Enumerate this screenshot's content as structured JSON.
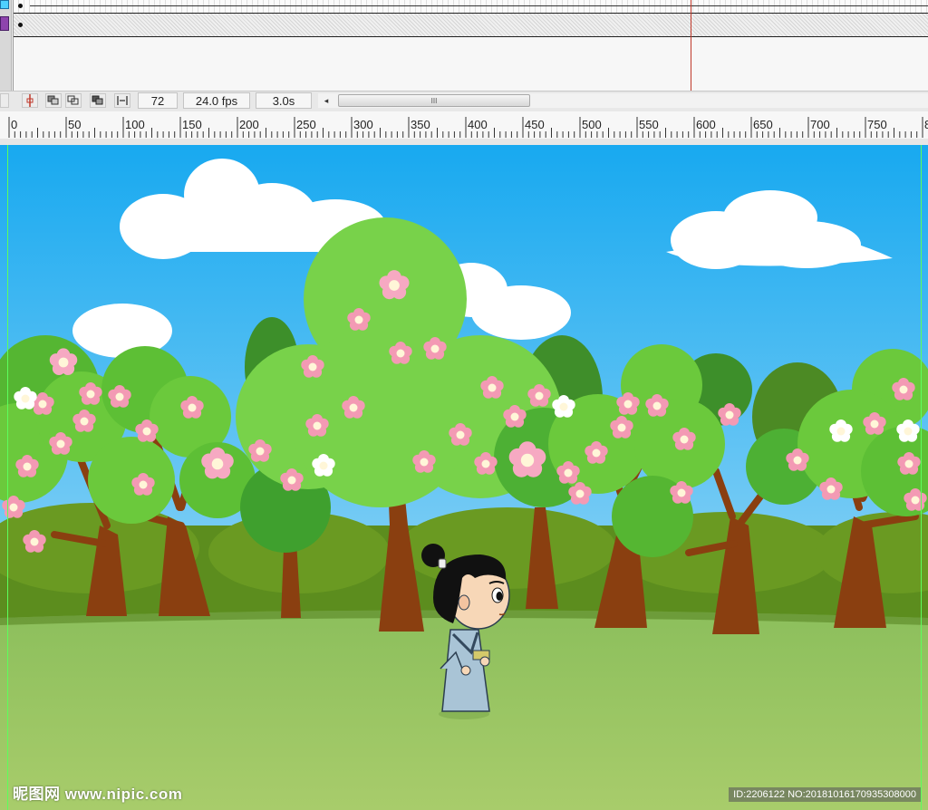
{
  "timeline": {
    "frame_count": "72",
    "frame_rate": "24.0 fps",
    "elapsed_time": "3.0s",
    "scroll_thumb_grip": "III",
    "scroll_left_arrow": "◂"
  },
  "ruler": {
    "labels": [
      "0",
      "50",
      "100",
      "150",
      "200",
      "250",
      "300",
      "350",
      "400",
      "450",
      "500",
      "550",
      "600",
      "650",
      "700",
      "750",
      "8"
    ]
  },
  "watermark": {
    "brand": "昵图网 www.nipic.com",
    "id_text": "ID:2206122 NO:20181016170935308000"
  },
  "colors": {
    "sky_top": "#18a9f0",
    "sky_bottom": "#b9e3f8",
    "grass_top": "#8cbf5c",
    "grass_bottom": "#a8cc6b",
    "trunk": "#8a3f10",
    "blossom": "#f39ab4",
    "playhead": "#c0392b",
    "guide": "#5cff5c"
  },
  "icons": [
    "onion-skin-icon",
    "onion-skin-outline-icon",
    "edit-multiple-frames-icon",
    "modify-markers-icon",
    "center-frame-icon",
    "scroll-left-arrow-icon"
  ]
}
